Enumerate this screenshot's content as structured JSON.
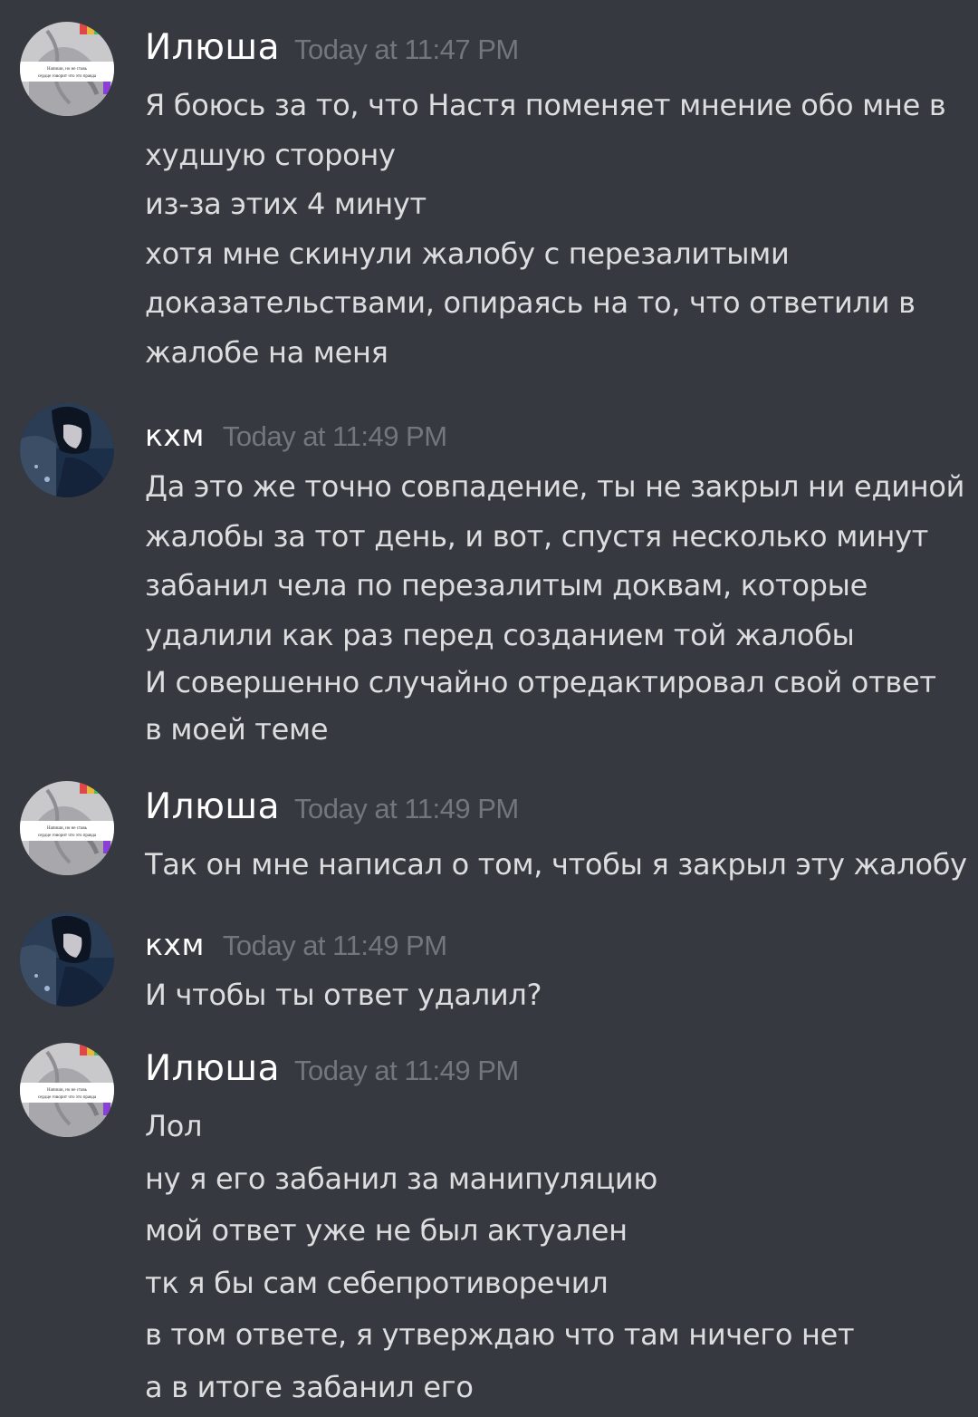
{
  "messages": [
    {
      "author": "Илюша",
      "timestamp": "Today at 11:47 PM",
      "lines": [
        "Я боюсь за то, что Настя поменяет мнение обо мне в",
        "худшую сторону",
        "из-за этих 4 минут",
        "хотя мне скинули жалобу с перезалитыми",
        "доказательствами, опираясь на то, что ответили в",
        "жалобе на меня"
      ]
    },
    {
      "author": "кхм",
      "timestamp": "Today at 11:49 PM",
      "lines": [
        "Да это же точно совпадение, ты не закрыл ни единой",
        "жалобы за тот день, и вот, спустя несколько минут",
        "забанил чела по перезалитым доквам, которые",
        "удалили как раз перед созданием той жалобы",
        "И совершенно случайно отредактировал свой ответ",
        "в моей теме"
      ]
    },
    {
      "author": "Илюша",
      "timestamp": "Today at 11:49 PM",
      "lines": [
        "Так он мне написал о том, чтобы я закрыл эту жалобу"
      ]
    },
    {
      "author": "кхм",
      "timestamp": "Today at 11:49 PM",
      "lines": [
        "И чтобы ты ответ удалил?"
      ]
    },
    {
      "author": "Илюша",
      "timestamp": "Today at 11:49 PM",
      "lines": [
        "Лол",
        "ну я его забанил за манипуляцию",
        "мой ответ уже не был актуален",
        "тк я бы сам себепротиворечил",
        "в том ответе, я утверждаю что там ничего нет",
        "а в итоге забанил его"
      ]
    }
  ],
  "avatar_caption": [
    "Напиши, но не ставь",
    "сердце говорит что это правда"
  ],
  "colors": {
    "background": "#36393f",
    "username": "#ffffff",
    "timestamp": "#72767d",
    "text": "#dcddde"
  }
}
